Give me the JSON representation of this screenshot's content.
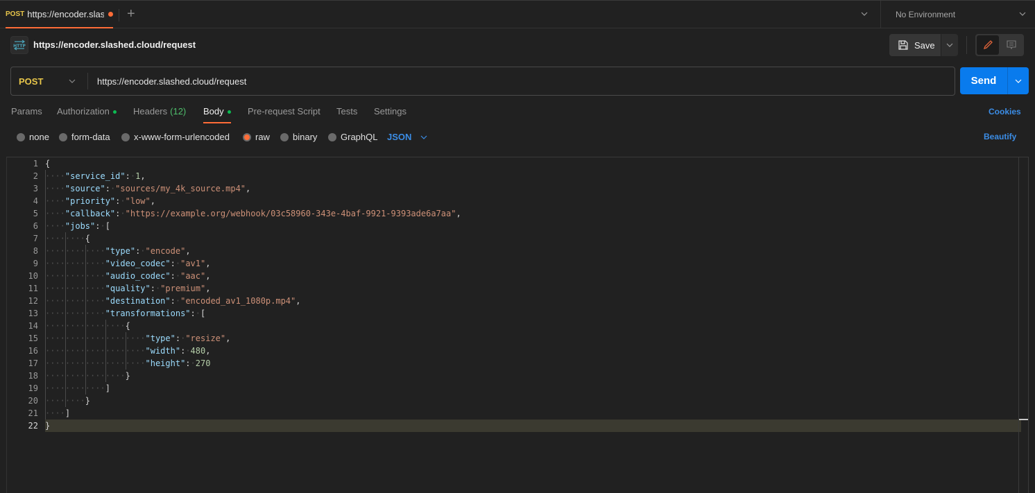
{
  "tabbar": {
    "tab": {
      "method": "POST",
      "title": "https://encoder.slashed.cloud/request",
      "unsaved": true
    },
    "add_tab_icon": "plus-icon",
    "environment": "No Environment"
  },
  "header": {
    "request_name": "https://encoder.slashed.cloud/request",
    "save_label": "Save"
  },
  "urlbar": {
    "method": "POST",
    "url": "https://encoder.slashed.cloud/request",
    "send_label": "Send"
  },
  "request_tabs": [
    {
      "label": "Params"
    },
    {
      "label": "Authorization",
      "dot": true
    },
    {
      "label": "Headers",
      "count": "(12)"
    },
    {
      "label": "Body",
      "dot": true,
      "active": true
    },
    {
      "label": "Pre-request Script"
    },
    {
      "label": "Tests"
    },
    {
      "label": "Settings"
    }
  ],
  "cookies_label": "Cookies",
  "body_types": [
    {
      "label": "none",
      "selected": false
    },
    {
      "label": "form-data",
      "selected": false
    },
    {
      "label": "x-www-form-urlencoded",
      "selected": false
    },
    {
      "label": "raw",
      "selected": true
    },
    {
      "label": "binary",
      "selected": false
    },
    {
      "label": "GraphQL",
      "selected": false
    }
  ],
  "raw_language": "JSON",
  "beautify_label": "Beautify",
  "editor": {
    "current_line": 22,
    "lines": [
      "{",
      "    \"service_id\": 1,",
      "    \"source\": \"sources/my_4k_source.mp4\",",
      "    \"priority\": \"low\",",
      "    \"callback\": \"https://example.org/webhook/03c58960-343e-4baf-9921-9393ade6a7aa\",",
      "    \"jobs\": [",
      "        {",
      "            \"type\": \"encode\",",
      "            \"video_codec\": \"av1\",",
      "            \"audio_codec\": \"aac\",",
      "            \"quality\": \"premium\",",
      "            \"destination\": \"encoded_av1_1080p.mp4\",",
      "            \"transformations\": [",
      "                {",
      "                    \"type\": \"resize\",",
      "                    \"width\": 480,",
      "                    \"height\": 270",
      "                }",
      "            ]",
      "        }",
      "    ]",
      "}"
    ]
  },
  "colors": {
    "accent": "#ff6c37",
    "send": "#097bed",
    "link": "#3b8de6",
    "method_post": "#e8c64a",
    "status_dot": "#0cbb52"
  }
}
